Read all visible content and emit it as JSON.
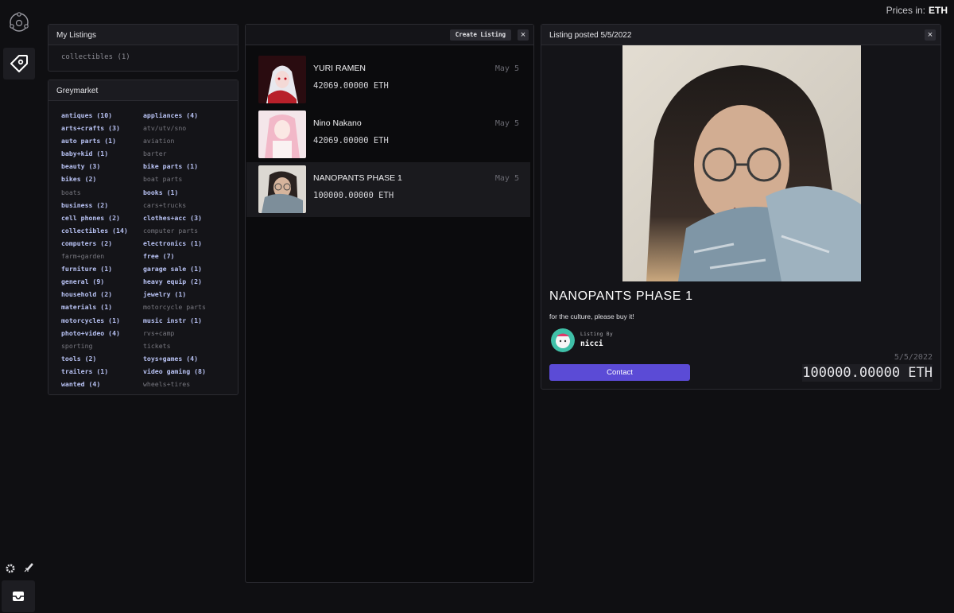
{
  "header": {
    "prices_label": "Prices in:",
    "currency": "ETH"
  },
  "my_listings": {
    "title": "My Listings",
    "items": [
      {
        "label": "collectibles (1)"
      }
    ]
  },
  "greymarket": {
    "title": "Greymarket",
    "categories_left": [
      {
        "label": "antiques (10)",
        "active": true
      },
      {
        "label": "arts+crafts (3)",
        "active": true
      },
      {
        "label": "auto parts (1)",
        "active": true
      },
      {
        "label": "baby+kid (1)",
        "active": true
      },
      {
        "label": "beauty (3)",
        "active": true
      },
      {
        "label": "bikes (2)",
        "active": true
      },
      {
        "label": "boats",
        "active": false
      },
      {
        "label": "business (2)",
        "active": true
      },
      {
        "label": "cell phones (2)",
        "active": true
      },
      {
        "label": "collectibles (14)",
        "active": true
      },
      {
        "label": "computers (2)",
        "active": true
      },
      {
        "label": "farm+garden",
        "active": false
      },
      {
        "label": "furniture (1)",
        "active": true
      },
      {
        "label": "general (9)",
        "active": true
      },
      {
        "label": "household (2)",
        "active": true
      },
      {
        "label": "materials (1)",
        "active": true
      },
      {
        "label": "motorcycles (1)",
        "active": true
      },
      {
        "label": "photo+video (4)",
        "active": true
      },
      {
        "label": "sporting",
        "active": false
      },
      {
        "label": "tools (2)",
        "active": true
      },
      {
        "label": "trailers (1)",
        "active": true
      },
      {
        "label": "wanted (4)",
        "active": true
      }
    ],
    "categories_right": [
      {
        "label": "appliances (4)",
        "active": true
      },
      {
        "label": "atv/utv/sno",
        "active": false
      },
      {
        "label": "aviation",
        "active": false
      },
      {
        "label": "barter",
        "active": false
      },
      {
        "label": "bike parts (1)",
        "active": true
      },
      {
        "label": "boat parts",
        "active": false
      },
      {
        "label": "books (1)",
        "active": true
      },
      {
        "label": "cars+trucks",
        "active": false
      },
      {
        "label": "clothes+acc (3)",
        "active": true
      },
      {
        "label": "computer parts",
        "active": false
      },
      {
        "label": "electronics (1)",
        "active": true
      },
      {
        "label": "free (7)",
        "active": true
      },
      {
        "label": "garage sale (1)",
        "active": true
      },
      {
        "label": "heavy equip (2)",
        "active": true
      },
      {
        "label": "jewelry (1)",
        "active": true
      },
      {
        "label": "motorcycle parts",
        "active": false
      },
      {
        "label": "music instr (1)",
        "active": true
      },
      {
        "label": "rvs+camp",
        "active": false
      },
      {
        "label": "tickets",
        "active": false
      },
      {
        "label": "toys+games (4)",
        "active": true
      },
      {
        "label": "video gaming (8)",
        "active": true
      },
      {
        "label": "wheels+tires",
        "active": false
      }
    ]
  },
  "listings_panel": {
    "create_label": "Create Listing",
    "close_icon": "×",
    "items": [
      {
        "title": "YURI RAMEN",
        "price": "42069.00000 ETH",
        "date": "May 5",
        "thumb": "anime-red"
      },
      {
        "title": "Nino Nakano",
        "price": "42069.00000 ETH",
        "date": "May 5",
        "thumb": "anime-pink"
      },
      {
        "title": "NANOPANTS PHASE 1",
        "price": "100000.00000 ETH",
        "date": "May 5",
        "thumb": "photo",
        "selected": true
      }
    ]
  },
  "detail": {
    "header": "Listing posted 5/5/2022",
    "close_icon": "×",
    "title": "NANOPANTS PHASE 1",
    "description": "for the culture, please buy it!",
    "listing_by_label": "Listing By",
    "seller": "nicci",
    "contact_label": "Contact",
    "date": "5/5/2022",
    "price": "100000.00000 ETH"
  }
}
